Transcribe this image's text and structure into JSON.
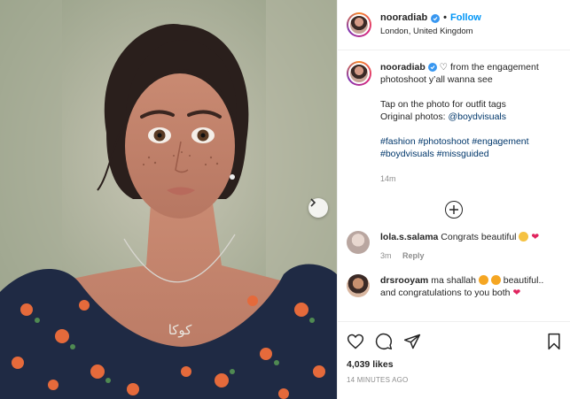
{
  "post": {
    "username": "nooradiab",
    "follow_label": "Follow",
    "location": "London, United Kingdom",
    "caption": {
      "text_main": "♡ from the engagement photoshoot y’all wanna see",
      "line_tap": "Tap on the photo for outfit tags",
      "line_original": "Original photos:",
      "mention": "@boydvisuals",
      "hashtags_line1": "#fashion #photoshoot #engagement",
      "hashtags_line2": "#boydvisuals #missguided",
      "time": "14m"
    },
    "necklace_text": "كوكا"
  },
  "comments": [
    {
      "username": "lola.s.salama",
      "text": "Congrats beautiful",
      "emojis": [
        "clap-emoji",
        "heart-emoji"
      ],
      "time": "3m",
      "reply": "Reply"
    },
    {
      "username": "drsrooyam",
      "text_a": "ma shallah",
      "text_b": "beautiful..",
      "text_c": "and congratulations to you both",
      "emojis": [
        "heart-eyes-emoji",
        "heart-eyes-emoji",
        "heart-emoji"
      ]
    }
  ],
  "footer": {
    "likes": "4,039 likes",
    "timestamp": "14 MINUTES AGO"
  },
  "colors": {
    "link": "#0095f6",
    "tag": "#00376b",
    "heart": "#e0245e",
    "verified": "#3897f0"
  }
}
